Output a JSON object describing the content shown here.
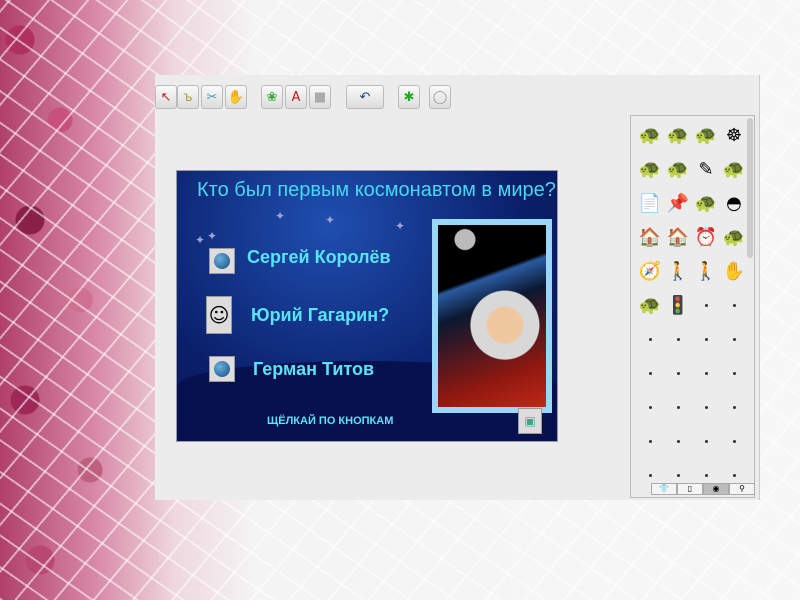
{
  "toolbar": {
    "tools": [
      {
        "name": "pointer-icon",
        "glyph": "↖"
      },
      {
        "name": "hatch-icon",
        "glyph": "ъ"
      },
      {
        "name": "scissors-icon",
        "glyph": "✂"
      },
      {
        "name": "stamp-icon",
        "glyph": "✋"
      },
      {
        "name": "new-turtle-icon",
        "glyph": "❀"
      },
      {
        "name": "text-icon",
        "glyph": "A"
      },
      {
        "name": "paint-icon",
        "glyph": "■"
      },
      {
        "name": "undo-icon",
        "glyph": "↶"
      },
      {
        "name": "turtle-icon",
        "glyph": "✱"
      },
      {
        "name": "circle-icon",
        "glyph": "◯"
      }
    ]
  },
  "slide": {
    "question": "Кто был первым космонавтом в мире?",
    "answers": [
      "Сергей Королёв",
      "Юрий Гагарин?",
      "Герман Титов"
    ],
    "hint": "ЩЁЛКАЙ ПО КНОПКАМ"
  },
  "palette": {
    "icons": [
      "🐢",
      "🐢",
      "🐢",
      "☸",
      "🐢",
      "🐢",
      "✎",
      "🐢",
      "📄",
      "📌",
      "🐢",
      "◓",
      "🏠",
      "🏠",
      "⏰",
      "🐢",
      "🧭",
      "🚶",
      "🚶",
      "✋",
      "🐢",
      "🚦"
    ],
    "tabs": [
      "shapes-tab",
      "page-tab",
      "procedures-tab",
      "turtles-tab"
    ],
    "tab_glyphs": [
      "👕",
      "▯",
      "◉",
      "⚲"
    ]
  },
  "colors": {
    "accent": "#46d8f0",
    "slide_bg": "#0a1f6a"
  }
}
